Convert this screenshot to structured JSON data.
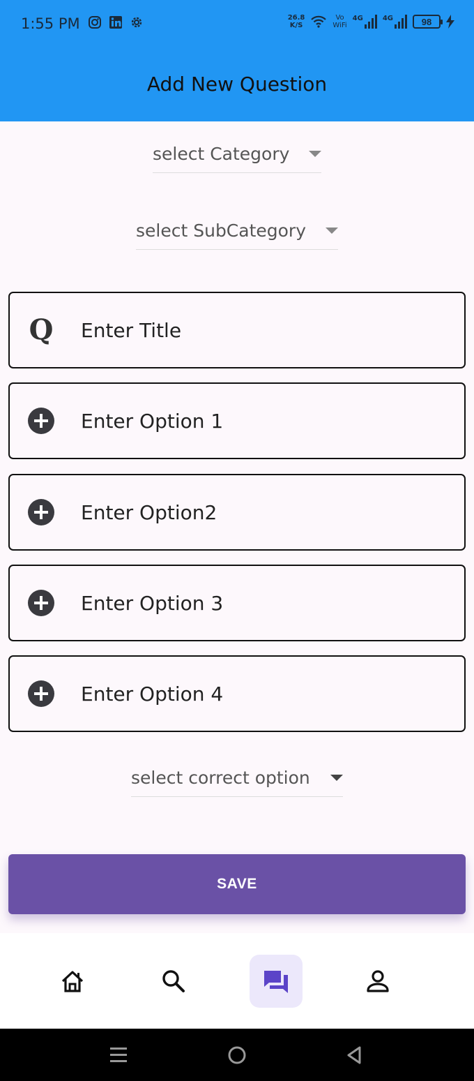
{
  "status_bar": {
    "time": "1:55 PM",
    "net_speed_value": "26.8",
    "net_speed_unit": "K/S",
    "vowifi_top": "Vo",
    "vowifi_bottom": "WiFi",
    "net1_label": "4G",
    "net2_label": "4G",
    "battery": "98",
    "notification_icons": [
      "instagram-icon",
      "linkedin-icon",
      "settings-gear-icon"
    ]
  },
  "app_bar": {
    "title": "Add New Question"
  },
  "form": {
    "category_dropdown": "select Category",
    "subcategory_dropdown": "select SubCategory",
    "title_placeholder": "Enter Title",
    "option1_placeholder": "Enter Option 1",
    "option2_placeholder": "Enter Option2",
    "option3_placeholder": "Enter Option 3",
    "option4_placeholder": "Enter Option 4",
    "correct_option_dropdown": "select correct option",
    "save_label": "SAVE",
    "title_icon_glyph": "Q"
  },
  "bottom_nav": {
    "items": [
      "home-icon",
      "search-icon",
      "forum-icon",
      "person-icon"
    ],
    "active_item": "forum-icon"
  },
  "colors": {
    "app_bar": "#2196f3",
    "save_button": "#6a51a6",
    "active_nav": "#ece8fb",
    "active_icon": "#5b44c8"
  }
}
